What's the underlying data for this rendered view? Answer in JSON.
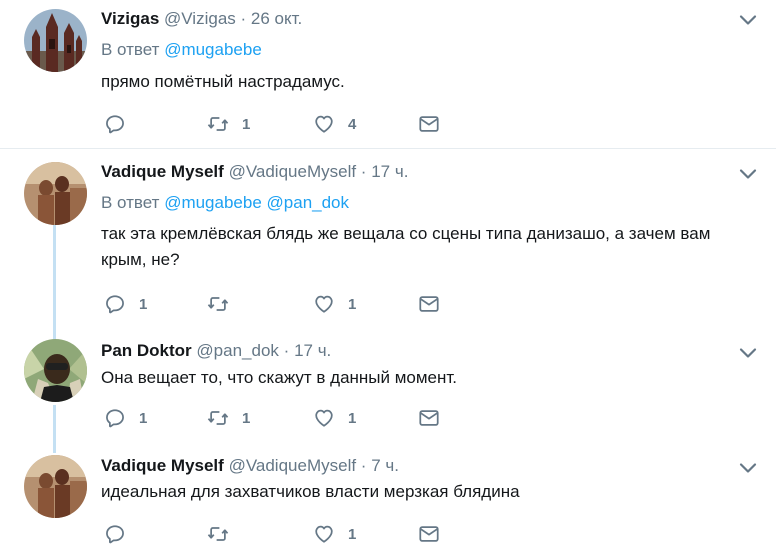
{
  "tweets": [
    {
      "name": "Vizigas",
      "handle": "@Vizigas",
      "dot": "·",
      "time": "26 окт.",
      "reply_label": "В ответ",
      "mentions": [
        "@mugabebe"
      ],
      "text": "прямо помётный настрадамус.",
      "replies": "",
      "retweets": "1",
      "likes": "4"
    },
    {
      "name": "Vadique Myself",
      "handle": "@VadiqueMyself",
      "dot": "·",
      "time": "17 ч.",
      "reply_label": "В ответ",
      "mentions": [
        "@mugabebe",
        "@pan_dok"
      ],
      "text_lines": [
        "так эта кремлёвская блядь же вещала со сцены типа данизашо, а зачем вам",
        "крым, не?"
      ],
      "replies": "1",
      "retweets": "",
      "likes": "1"
    },
    {
      "name": "Pan Doktor",
      "handle": "@pan_dok",
      "dot": "·",
      "time": "17 ч.",
      "text": "Она вещает то, что скажут в данный момент.",
      "replies": "1",
      "retweets": "1",
      "likes": "1"
    },
    {
      "name": "Vadique Myself",
      "handle": "@VadiqueMyself",
      "dot": "·",
      "time": "7 ч.",
      "text": "идеальная для захватчиков власти мерзкая блядина",
      "replies": "",
      "retweets": "",
      "likes": "1"
    }
  ],
  "icons": {
    "reply": "reply-icon",
    "retweet": "retweet-icon",
    "like": "heart-icon",
    "dm": "envelope-icon",
    "more": "chevron-down-icon"
  },
  "colors": {
    "icon": "#657786",
    "mention": "#1da1f2",
    "thread_line": "#c4e0f3",
    "separator": "#e6ecf0"
  }
}
